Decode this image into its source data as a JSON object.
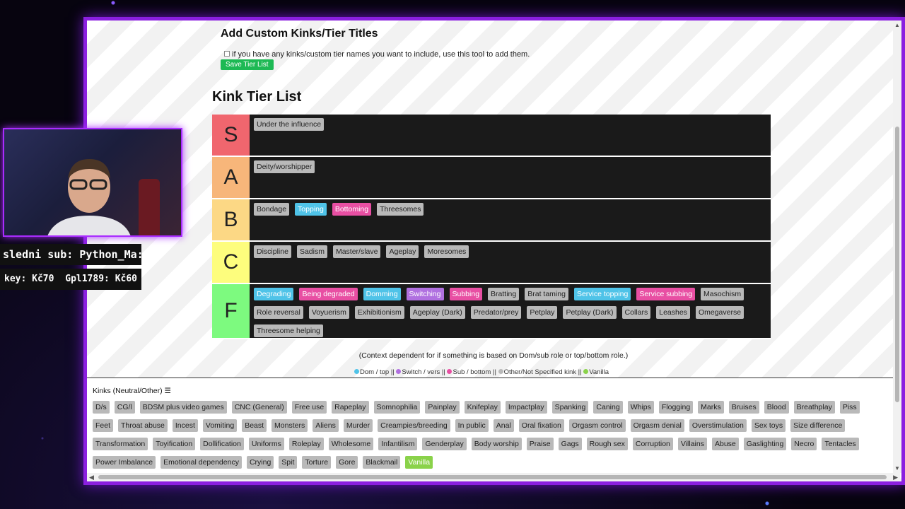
{
  "custom": {
    "title": "Add Custom Kinks/Tier Titles",
    "description": "if you have any kinks/custom tier names you want to include, use this tool to add them.",
    "save_button": "Save Tier List"
  },
  "tier_list": {
    "title": "Kink Tier List",
    "tiers": [
      {
        "label": "S",
        "color": "#f0666e",
        "items": [
          {
            "text": "Under the influence",
            "kind": "other"
          }
        ]
      },
      {
        "label": "A",
        "color": "#f7b67a",
        "items": [
          {
            "text": "Deity/worshipper",
            "kind": "other"
          }
        ]
      },
      {
        "label": "B",
        "color": "#fcd885",
        "items": [
          {
            "text": "Bondage",
            "kind": "other"
          },
          {
            "text": "Topping",
            "kind": "dom"
          },
          {
            "text": "Bottoming",
            "kind": "sub"
          },
          {
            "text": "Threesomes",
            "kind": "other"
          }
        ]
      },
      {
        "label": "C",
        "color": "#fdfd7d",
        "items": [
          {
            "text": "Discipline",
            "kind": "other"
          },
          {
            "text": "Sadism",
            "kind": "other"
          },
          {
            "text": "Master/slave",
            "kind": "other"
          },
          {
            "text": "Ageplay",
            "kind": "other"
          },
          {
            "text": "Moresomes",
            "kind": "other"
          }
        ]
      },
      {
        "label": "F",
        "color": "#7dfa7f",
        "items": [
          {
            "text": "Degrading",
            "kind": "dom"
          },
          {
            "text": "Being degraded",
            "kind": "sub"
          },
          {
            "text": "Domming",
            "kind": "dom"
          },
          {
            "text": "Switching",
            "kind": "switch"
          },
          {
            "text": "Subbing",
            "kind": "sub"
          },
          {
            "text": "Bratting",
            "kind": "other"
          },
          {
            "text": "Brat taming",
            "kind": "other"
          },
          {
            "text": "Service topping",
            "kind": "dom"
          },
          {
            "text": "Service subbing",
            "kind": "sub"
          },
          {
            "text": "Masochism",
            "kind": "other"
          },
          {
            "text": "Role reversal",
            "kind": "other"
          },
          {
            "text": "Voyuerism",
            "kind": "other"
          },
          {
            "text": "Exhibitionism",
            "kind": "other"
          },
          {
            "text": "Ageplay (Dark)",
            "kind": "other"
          },
          {
            "text": "Predator/prey",
            "kind": "other"
          },
          {
            "text": "Petplay",
            "kind": "other"
          },
          {
            "text": "Petplay (Dark)",
            "kind": "other"
          },
          {
            "text": "Collars",
            "kind": "other"
          },
          {
            "text": "Leashes",
            "kind": "other"
          },
          {
            "text": "Omegaverse",
            "kind": "other"
          },
          {
            "text": "Threesome helping",
            "kind": "other"
          }
        ]
      }
    ],
    "context_note": "(Context dependent for if something is based on Dom/sub role or top/bottom role.)",
    "legend": [
      {
        "text": "Dom / top",
        "color": "#4fc3e8"
      },
      {
        "text": "Switch / vers",
        "color": "#b070e0"
      },
      {
        "text": "Sub / bottom",
        "color": "#e84fa3"
      },
      {
        "text": "Other/Not Specified kink",
        "color": "#b9b9b9"
      },
      {
        "text": "Vanilla",
        "color": "#8ad24a"
      }
    ]
  },
  "pool": {
    "title": "Kinks (Neutral/Other) ☰",
    "items": [
      {
        "text": "D/s",
        "kind": "other"
      },
      {
        "text": "CG/l",
        "kind": "other"
      },
      {
        "text": "BDSM plus video games",
        "kind": "other"
      },
      {
        "text": "CNC (General)",
        "kind": "other"
      },
      {
        "text": "Free use",
        "kind": "other"
      },
      {
        "text": "Rapeplay",
        "kind": "other"
      },
      {
        "text": "Somnophilia",
        "kind": "other"
      },
      {
        "text": "Painplay",
        "kind": "other"
      },
      {
        "text": "Knifeplay",
        "kind": "other"
      },
      {
        "text": "Impactplay",
        "kind": "other"
      },
      {
        "text": "Spanking",
        "kind": "other"
      },
      {
        "text": "Caning",
        "kind": "other"
      },
      {
        "text": "Whips",
        "kind": "other"
      },
      {
        "text": "Flogging",
        "kind": "other"
      },
      {
        "text": "Marks",
        "kind": "other"
      },
      {
        "text": "Bruises",
        "kind": "other"
      },
      {
        "text": "Blood",
        "kind": "other"
      },
      {
        "text": "Breathplay",
        "kind": "other"
      },
      {
        "text": "Piss",
        "kind": "other"
      },
      {
        "text": "Feet",
        "kind": "other"
      },
      {
        "text": "Throat abuse",
        "kind": "other"
      },
      {
        "text": "Incest",
        "kind": "other"
      },
      {
        "text": "Vomiting",
        "kind": "other"
      },
      {
        "text": "Beast",
        "kind": "other"
      },
      {
        "text": "Monsters",
        "kind": "other"
      },
      {
        "text": "Aliens",
        "kind": "other"
      },
      {
        "text": "Murder",
        "kind": "other"
      },
      {
        "text": "Creampies/breeding",
        "kind": "other"
      },
      {
        "text": "In public",
        "kind": "other"
      },
      {
        "text": "Anal",
        "kind": "other"
      },
      {
        "text": "Oral fixation",
        "kind": "other"
      },
      {
        "text": "Orgasm control",
        "kind": "other"
      },
      {
        "text": "Orgasm denial",
        "kind": "other"
      },
      {
        "text": "Overstimulation",
        "kind": "other"
      },
      {
        "text": "Sex toys",
        "kind": "other"
      },
      {
        "text": "Size difference",
        "kind": "other"
      },
      {
        "text": "Transformation",
        "kind": "other"
      },
      {
        "text": "Toyification",
        "kind": "other"
      },
      {
        "text": "Dollification",
        "kind": "other"
      },
      {
        "text": "Uniforms",
        "kind": "other"
      },
      {
        "text": "Roleplay",
        "kind": "other"
      },
      {
        "text": "Wholesome",
        "kind": "other"
      },
      {
        "text": "Infantilism",
        "kind": "other"
      },
      {
        "text": "Genderplay",
        "kind": "other"
      },
      {
        "text": "Body worship",
        "kind": "other"
      },
      {
        "text": "Praise",
        "kind": "other"
      },
      {
        "text": "Gags",
        "kind": "other"
      },
      {
        "text": "Rough sex",
        "kind": "other"
      },
      {
        "text": "Corruption",
        "kind": "other"
      },
      {
        "text": "Villains",
        "kind": "other"
      },
      {
        "text": "Abuse",
        "kind": "other"
      },
      {
        "text": "Gaslighting",
        "kind": "other"
      },
      {
        "text": "Necro",
        "kind": "other"
      },
      {
        "text": "Tentacles",
        "kind": "other"
      },
      {
        "text": "Power Imbalance",
        "kind": "other"
      },
      {
        "text": "Emotional dependency",
        "kind": "other"
      },
      {
        "text": "Crying",
        "kind": "other"
      },
      {
        "text": "Spit",
        "kind": "other"
      },
      {
        "text": "Torture",
        "kind": "other"
      },
      {
        "text": "Gore",
        "kind": "other"
      },
      {
        "text": "Blackmail",
        "kind": "other"
      },
      {
        "text": "Vanilla",
        "kind": "vanilla"
      }
    ]
  },
  "overlay": {
    "last_sub": "sledni sub: Python_Ma:",
    "donor_left": "key: Kč70",
    "donor_right": "Gpl1789: Kč60"
  }
}
